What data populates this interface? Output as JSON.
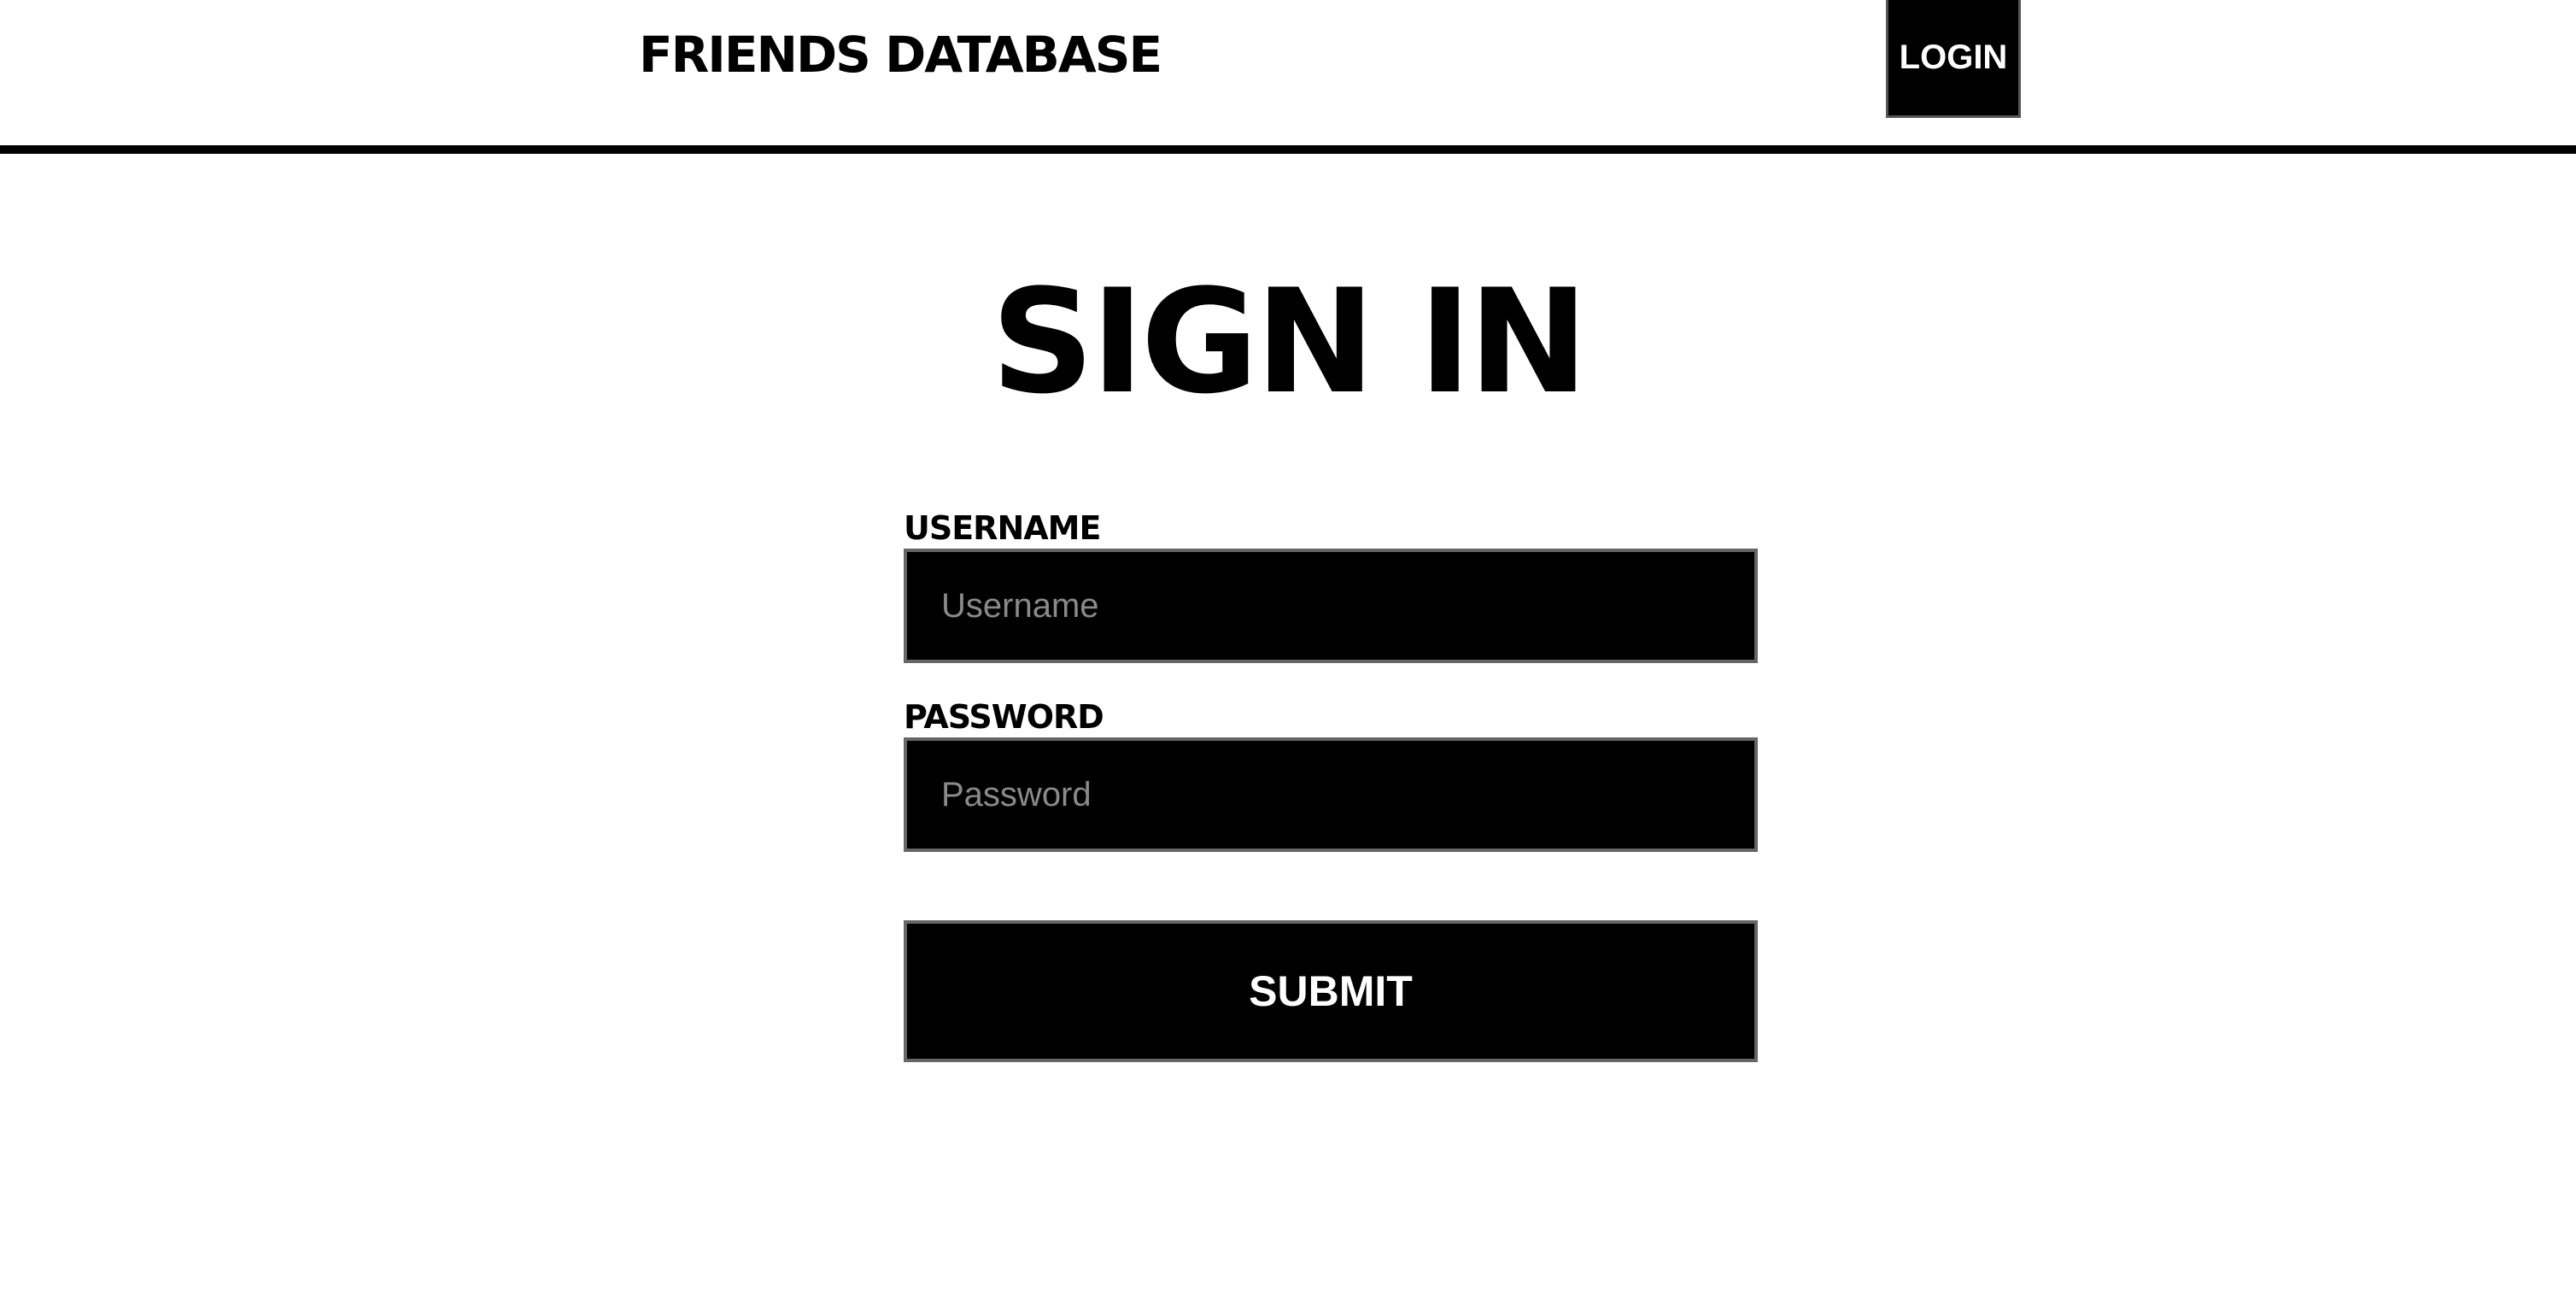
{
  "header": {
    "brand": "FRIENDS DATABASE",
    "login_label": "LOGIN"
  },
  "main": {
    "title": "SIGN IN",
    "username": {
      "label": "USERNAME",
      "placeholder": "Username",
      "value": ""
    },
    "password": {
      "label": "PASSWORD",
      "placeholder": "Password",
      "value": ""
    },
    "submit_label": "SUBMIT"
  },
  "colors": {
    "background": "#ffffff",
    "foreground": "#000000",
    "button_text": "#ffffff",
    "placeholder": "#8a8a8a",
    "input_border": "#666666"
  }
}
